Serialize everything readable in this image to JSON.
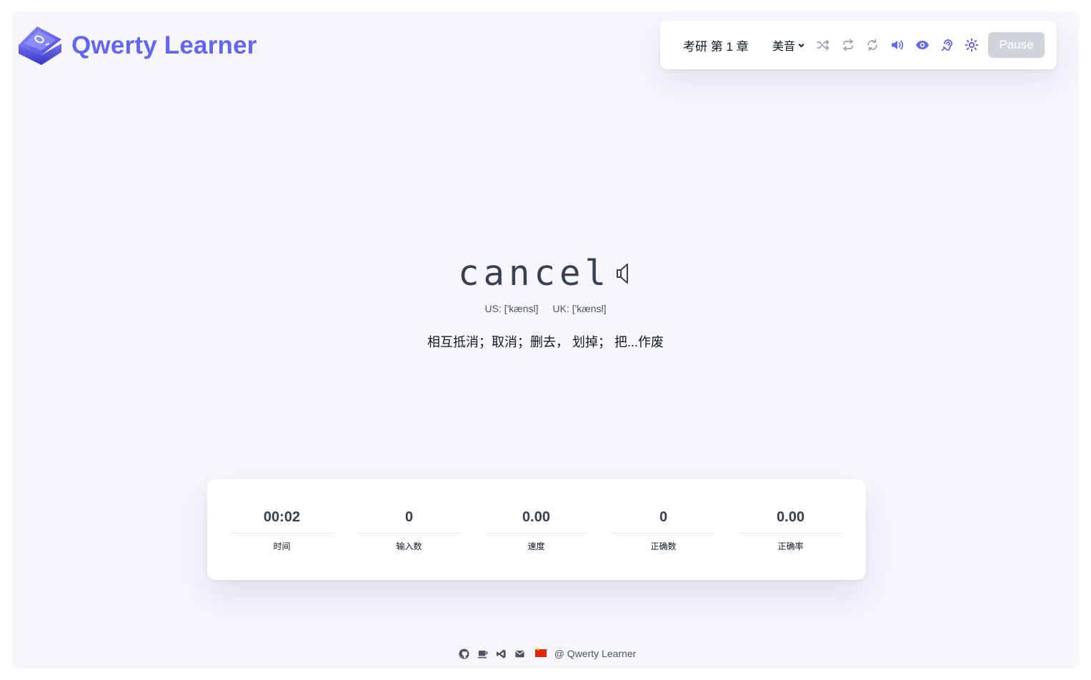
{
  "app": {
    "title": "Qwerty Learner"
  },
  "toolbar": {
    "chapter": "考研 第 1 章",
    "accent": "美音",
    "icons": [
      "shuffle-icon",
      "loop-icon",
      "repeat-icon",
      "volume-icon",
      "eye-icon",
      "hearing-icon",
      "theme-icon"
    ],
    "pause_label": "Pause",
    "accent_color": "#6366f1"
  },
  "word": {
    "text": "cancel",
    "us_phonetic": "US: ['kænsl]",
    "uk_phonetic": "UK: ['kænsl]",
    "translation": "相互抵消；取消；删去， 划掉； 把...作废"
  },
  "stats": [
    {
      "value": "00:02",
      "label": "时间"
    },
    {
      "value": "0",
      "label": "输入数"
    },
    {
      "value": "0.00",
      "label": "速度"
    },
    {
      "value": "0",
      "label": "正确数"
    },
    {
      "value": "0.00",
      "label": "正确率"
    }
  ],
  "footer": {
    "icons": [
      "github-icon",
      "coffee-icon",
      "vscode-icon",
      "mail-icon",
      "china-flag-icon"
    ],
    "copyright": "@ Qwerty Learner"
  }
}
